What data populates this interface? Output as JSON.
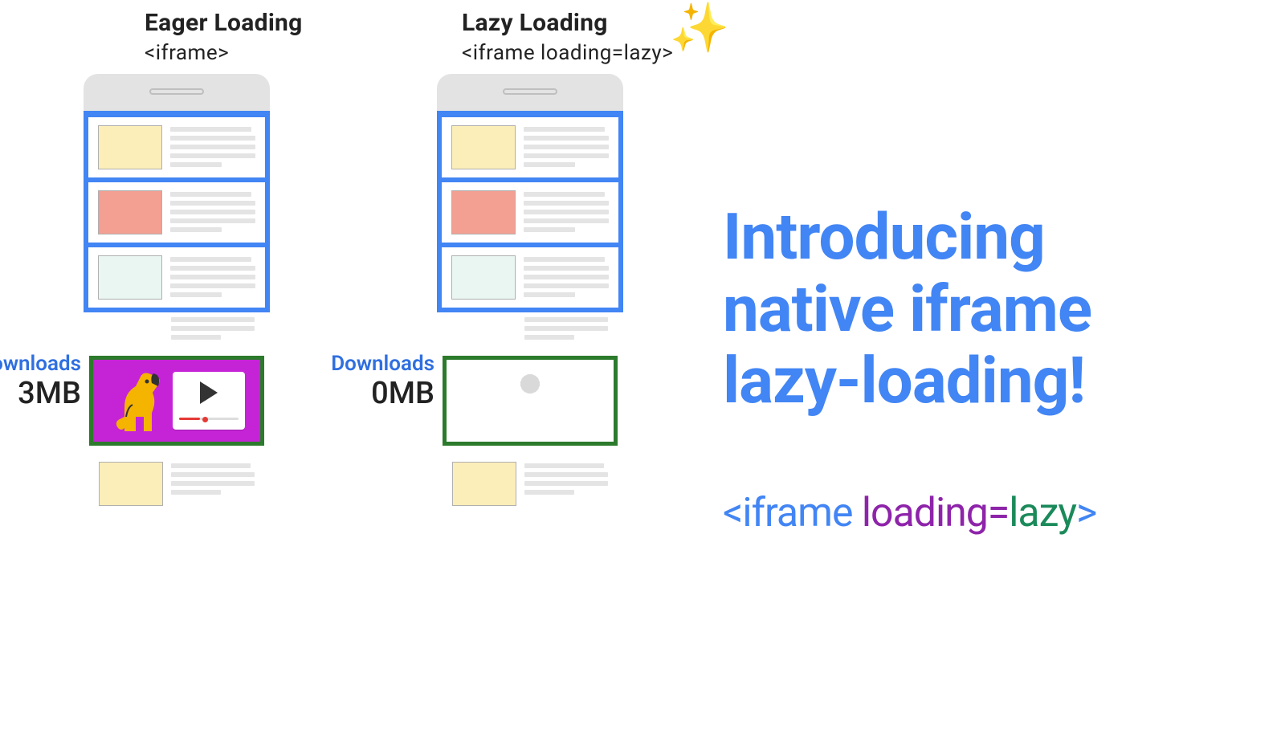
{
  "columns": {
    "eager": {
      "title": "Eager Loading",
      "subtitle": "<iframe>",
      "download_label": "Downloads",
      "download_value": "3MB"
    },
    "lazy": {
      "title": "Lazy Loading",
      "subtitle": "<iframe loading=lazy>",
      "download_label": "Downloads",
      "download_value": "0MB",
      "sparkle_icon": "✨"
    }
  },
  "headline_lines": [
    "Introducing",
    "native iframe",
    "lazy-loading!"
  ],
  "code_snippet": {
    "open": "<iframe ",
    "attr": "loading=",
    "val": "lazy",
    "close": ">"
  }
}
